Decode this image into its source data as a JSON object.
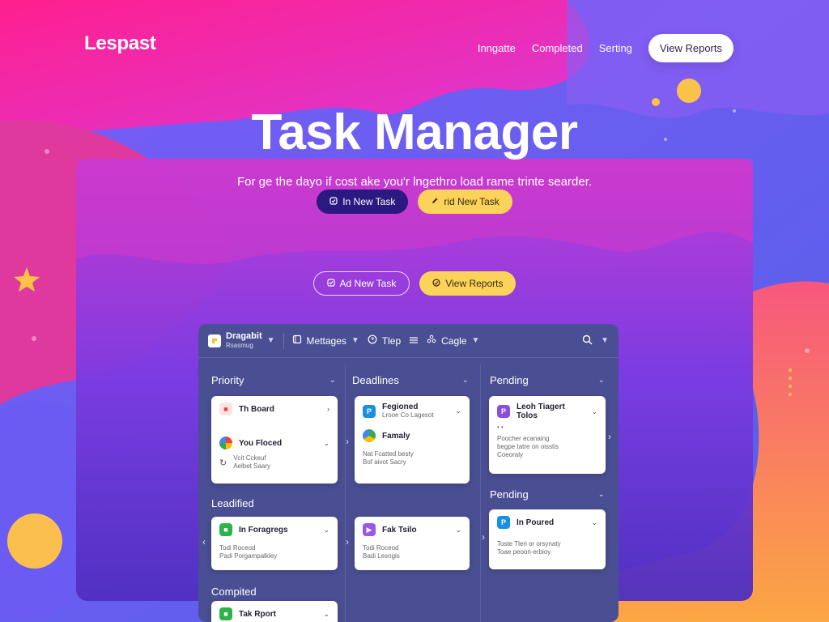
{
  "app": {
    "logo": "Lespast"
  },
  "nav": {
    "links": [
      "Inngatte",
      "Completed",
      "Serting"
    ],
    "cta": "View Reports"
  },
  "hero": {
    "title": "Task Manager",
    "subtitle": "For ge the dayo if cost ake you'r lngethro load rame trinte searder.",
    "buttons_primary": [
      {
        "label": "In New Task",
        "icon": "task-icon"
      },
      {
        "label": "rid New Task",
        "icon": "pen-icon"
      }
    ],
    "buttons_secondary": [
      {
        "label": "Ad New Task",
        "icon": "task-icon"
      },
      {
        "label": "View Reports",
        "icon": "report-icon"
      }
    ]
  },
  "toolbar": {
    "app_name": "Dragabit",
    "app_sub": "Rsasmug",
    "messages": "Mettages",
    "help": "Tlep",
    "google": "Cagle"
  },
  "columns": {
    "priority": "Priority",
    "deadlines": "Deadlines",
    "pending": "Pending",
    "pending2": "Pending",
    "leadified": "Leadified",
    "completed": "Compited"
  },
  "cards": {
    "priority": {
      "item1": "Th Board",
      "item2": "You Floced",
      "meta1": "Vcit Cckeuf",
      "meta2": "Aelbet Saary"
    },
    "deadlines": {
      "title": "Fegioned",
      "sub": "Lrooe Co Lagesot",
      "item2": "Famaly",
      "meta1": "Nat Fcatted besty",
      "meta2": "Bof aivot Sacry"
    },
    "pending": {
      "title": "Leoh Tiagert",
      "title2": "Tolos",
      "dots": "• •",
      "meta1": "Poocher ecanaing",
      "meta2": "begpe tatre on oisstis",
      "meta3": "Coeoraly"
    },
    "leadified": {
      "title": "In Foragregs",
      "meta1": "Todi Roceod",
      "meta2": "Padi Porgampalkley"
    },
    "fak": {
      "title": "Fak Tsilo",
      "meta1": "Todi Roceod",
      "meta2": "Badi Lesngis"
    },
    "pending2": {
      "title": "In Poured",
      "meta1": "Toste Tleri or orsynaty",
      "meta2": "Toae peoon-erbioy"
    },
    "completed": {
      "title": "Tak Rport"
    }
  },
  "colors": {
    "dark_button": "#2b1880",
    "yellow_button": "#fbd35b",
    "board_bg": "#4a4f93"
  }
}
